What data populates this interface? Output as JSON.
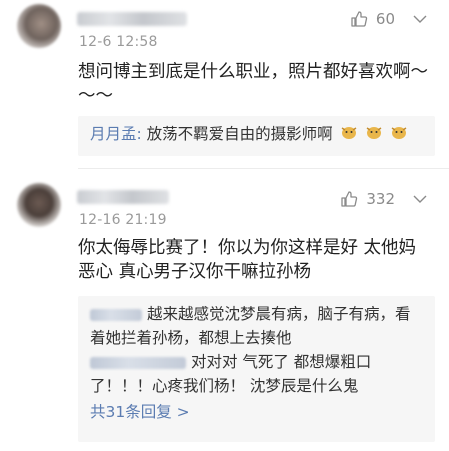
{
  "comments": [
    {
      "time": "12-6 12:58",
      "likes": "60",
      "text": "想问博主到底是什么职业，照片都好喜欢啊～～～",
      "reply": {
        "author": "月月孟:",
        "text": "放荡不羁爱自由的摄影师啊",
        "emoji": [
          "doge-emoji",
          "doge-emoji",
          "doge-emoji"
        ]
      }
    },
    {
      "time": "12-16 21:19",
      "likes": "332",
      "text": "你太侮辱比赛了！你以为你这样是好 太他妈恶心 真心男子汉你干嘛拉孙杨",
      "replies": [
        {
          "text": "越来越感觉沈梦晨有病，脑子有病，看着她拦着孙杨，都想上去揍他"
        },
        {
          "text": "对对对 气死了 都想爆粗口了！！！心疼我们杨！ 沈梦辰是什么鬼"
        }
      ],
      "more": "共31条回复 >"
    }
  ]
}
